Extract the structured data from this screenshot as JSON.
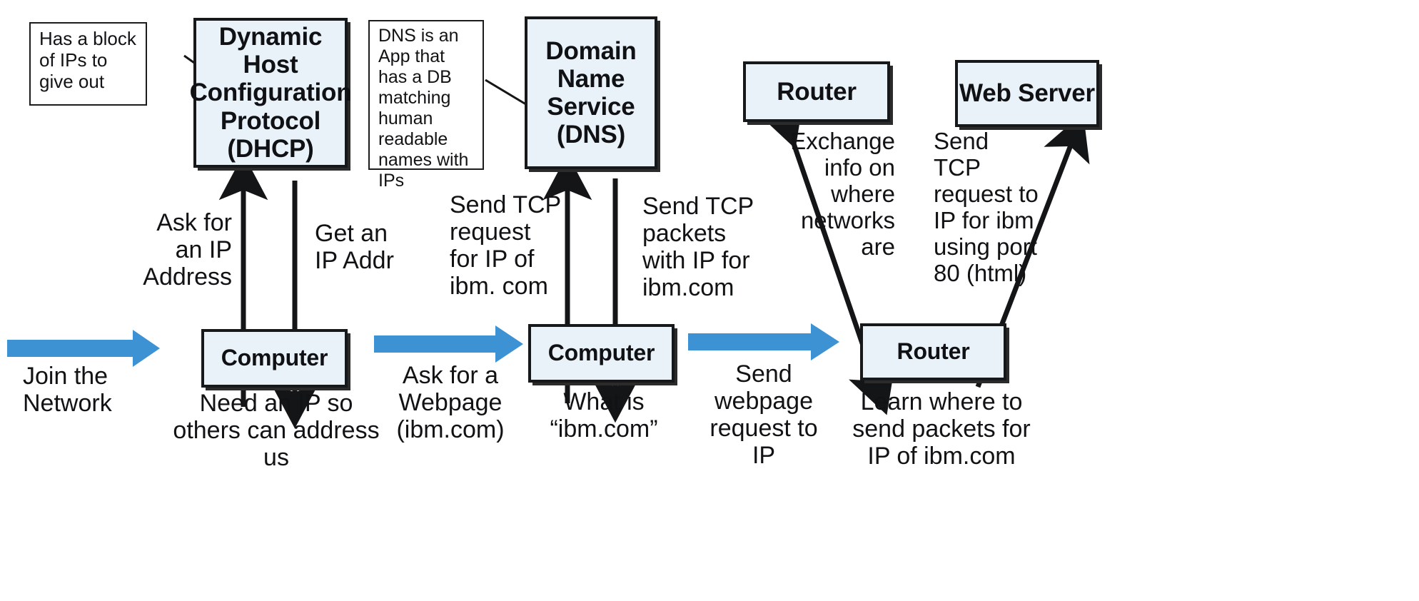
{
  "colors": {
    "node_fill": "#eaf2f9",
    "node_border": "#17181a",
    "flow_arrow": "#3d92d4",
    "connector": "#141517",
    "text": "#111214",
    "canvas": "#ffffff"
  },
  "nodes": {
    "dhcp": "Dynamic Host Configuration Protocol (DHCP)",
    "dns": "Domain Name Service (DNS)",
    "router_top": "Router",
    "web_server": "Web Server",
    "computer_1": "Computer",
    "computer_2": "Computer",
    "router_bottom": "Router"
  },
  "notes": {
    "dhcp_note": "Has a block of IPs to give out",
    "dns_note": "DNS is an App that has a DB matching human readable names with IPs"
  },
  "vertical_arrow_labels": {
    "ask_for_ip": "Ask for\nan IP\nAddress",
    "get_ip_addr": "Get an\nIP Addr",
    "send_tcp_request": "Send TCP\nrequest\nfor IP of\nibm. com",
    "send_tcp_packets": "Send TCP\npackets\nwith IP for\nibm.com",
    "exchange_info": "Exchange\ninfo on\nwhere\nnetworks\nare",
    "send_tcp_port80": "Send\nTCP\nrequest to\nIP for ibm\nusing port\n80 (html)"
  },
  "flow_arrow_labels": {
    "join_network": "Join the\nNetwork",
    "ask_webpage": "Ask for a\nWebpage\n(ibm.com)",
    "send_webpage_request": "Send\nwebpage\nrequest to\nIP"
  },
  "node_captions": {
    "computer_1": "Need an IP so\nothers can address\nus",
    "computer_2": "What is\n“ibm.com”",
    "router_bottom": "Learn where to\nsend packets for\nIP of ibm.com"
  }
}
